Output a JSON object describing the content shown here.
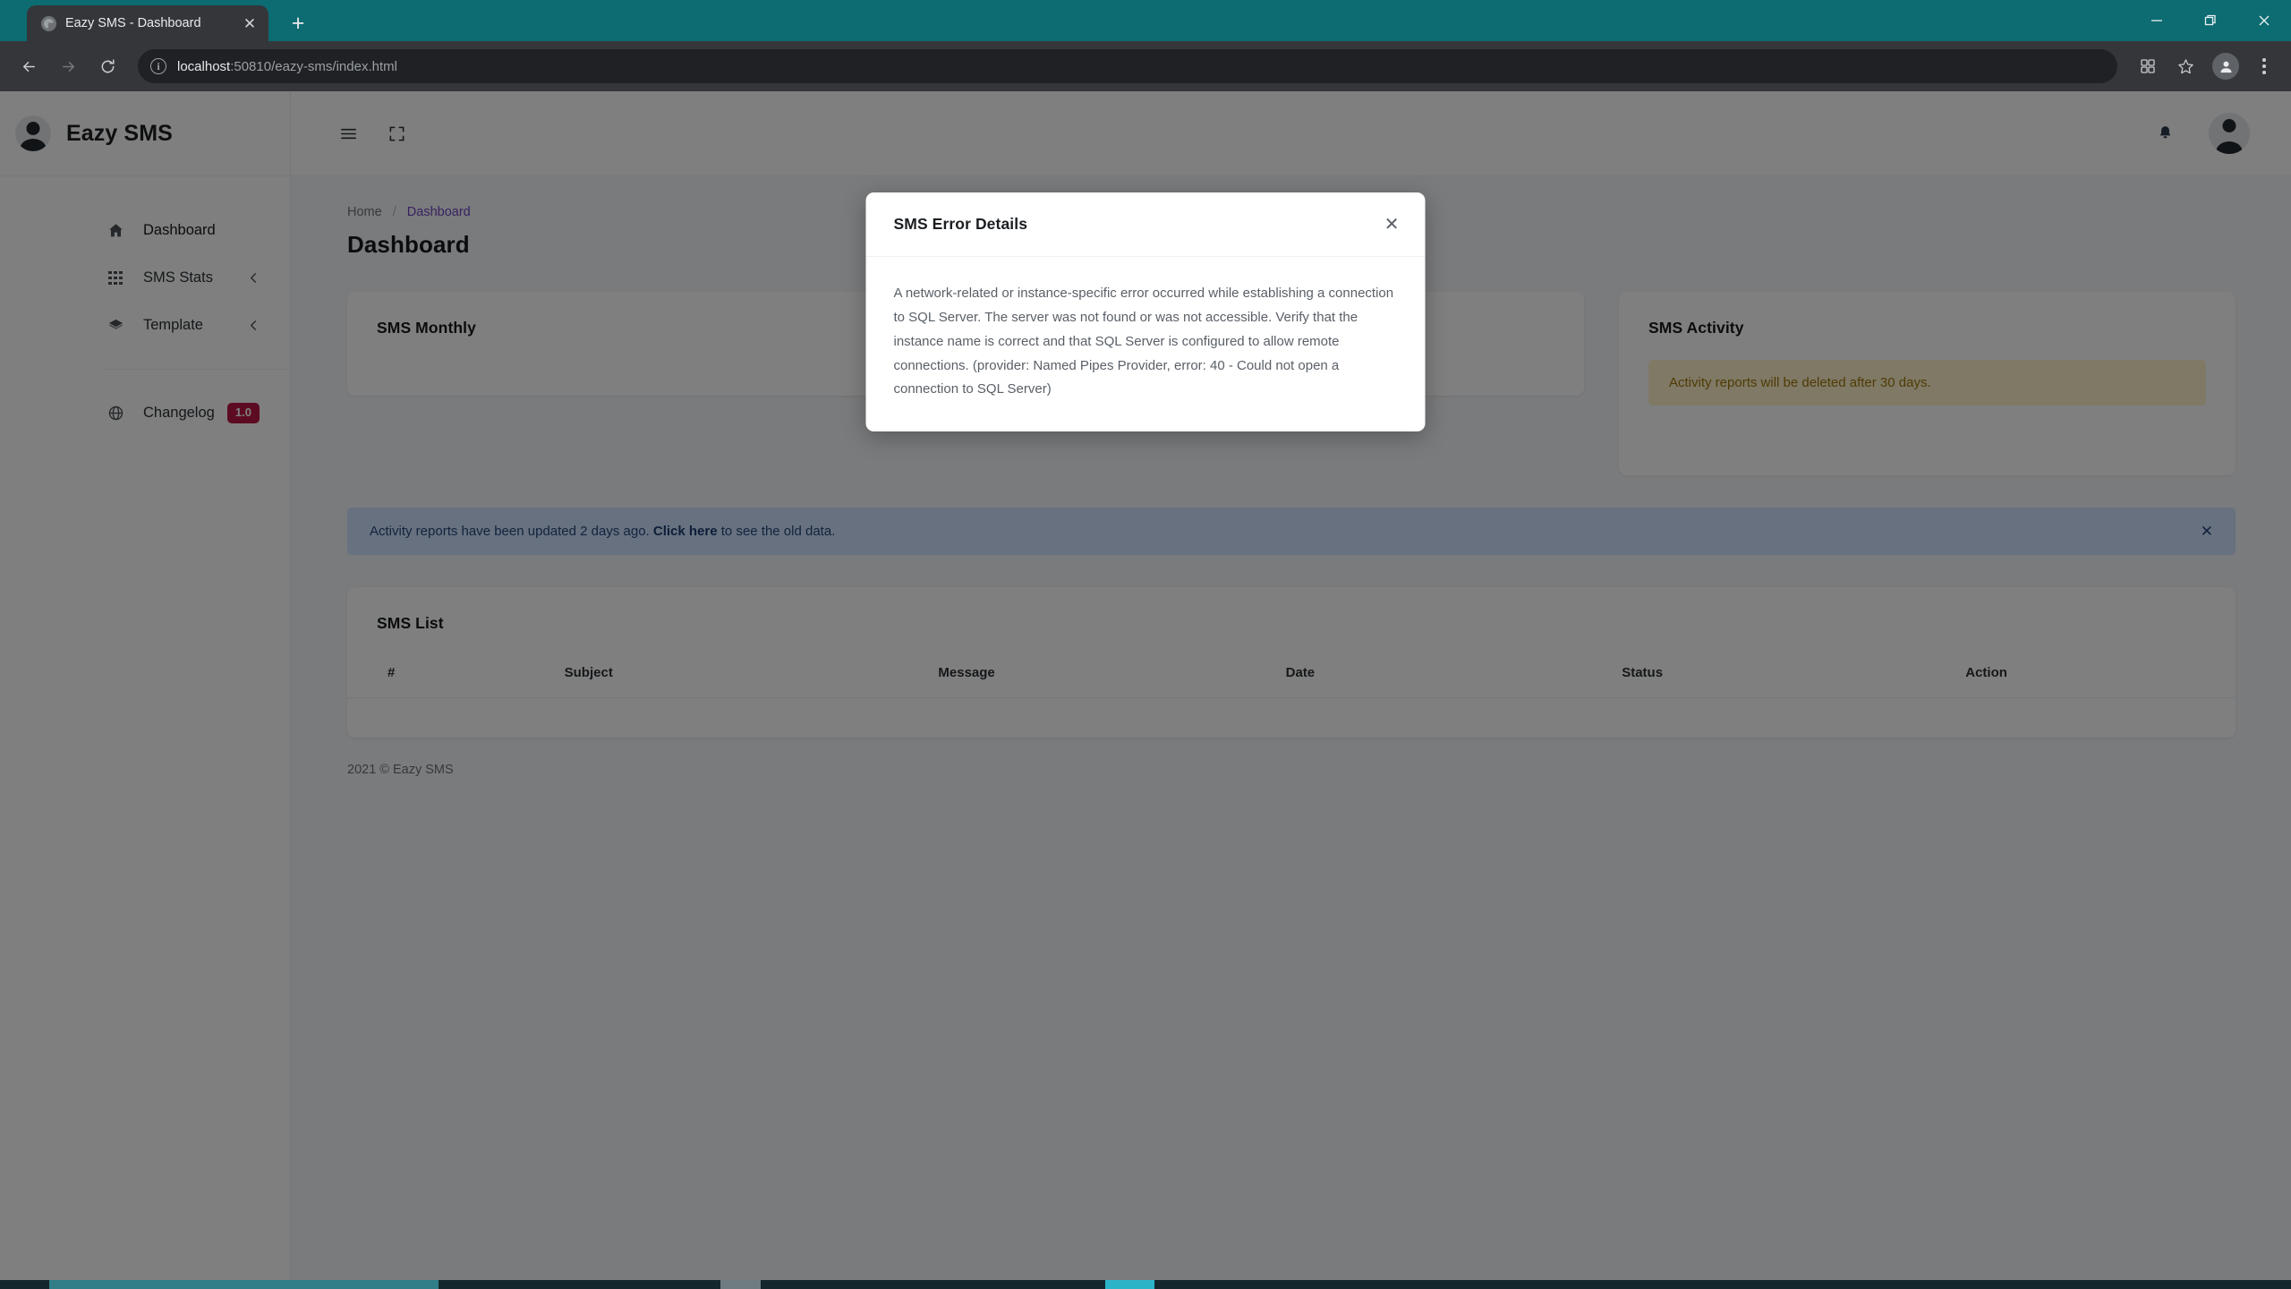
{
  "browser": {
    "tab": {
      "title": "Eazy SMS - Dashboard",
      "favicon_icon": "globe-icon",
      "close_icon": "close-icon"
    },
    "new_tab_label": "+",
    "window_controls": {
      "minimize": "minimize-icon",
      "restore": "restore-icon",
      "close": "close-icon"
    },
    "toolbar": {
      "back_icon": "back-arrow-icon",
      "forward_icon": "forward-arrow-icon",
      "reload_icon": "reload-icon",
      "site_info_icon": "info-icon",
      "url_host": "localhost",
      "url_rest": ":50810/eazy-sms/index.html",
      "extensions_icon": "extensions-icon",
      "bookmark_icon": "star-icon",
      "profile_icon": "profile-avatar-icon",
      "menu_icon": "kebab-menu-icon"
    }
  },
  "sidebar": {
    "brand": "Eazy SMS",
    "avatar_icon": "user-avatar-icon",
    "items": [
      {
        "label": "Dashboard",
        "icon": "home-icon",
        "active": true
      },
      {
        "label": "SMS Stats",
        "icon": "grid-icon",
        "chevron": "chevron-left-icon"
      },
      {
        "label": "Template",
        "icon": "layers-icon",
        "chevron": "chevron-left-icon"
      },
      {
        "label": "Changelog",
        "icon": "globe-icon",
        "badge": "1.0"
      }
    ]
  },
  "topbar": {
    "menu_toggle_icon": "hamburger-menu-icon",
    "fullscreen_icon": "fullscreen-icon",
    "notification_icon": "bell-icon",
    "avatar_icon": "user-avatar-icon"
  },
  "breadcrumb": {
    "home": "Home",
    "separator": "/",
    "current": "Dashboard"
  },
  "page_title": "Dashboard",
  "cards": {
    "monthly": {
      "title": "SMS Monthly"
    },
    "activity": {
      "title": "SMS Activity",
      "alert": "Activity reports will be deleted after 30 days."
    }
  },
  "info_alert": {
    "text_before": "Activity reports have been updated 2 days ago. ",
    "link": "Click here",
    "text_after": " to see the old data.",
    "close_icon": "close-icon"
  },
  "sms_list": {
    "title": "SMS List",
    "columns": [
      "#",
      "Subject",
      "Message",
      "Date",
      "Status",
      "Action"
    ],
    "rows": []
  },
  "footer": "2021 © Eazy SMS",
  "modal": {
    "title": "SMS Error Details",
    "close_icon": "close-icon",
    "body": "A network-related or instance-specific error occurred while establishing a connection to SQL Server. The server was not found or was not accessible. Verify that the instance name is correct and that SQL Server is configured to allow remote connections. (provider: Named Pipes Provider, error: 40 - Could not open a connection to SQL Server)"
  },
  "colors": {
    "tabstrip": "#0d6b72",
    "accent_purple": "#6f42c1",
    "badge_crimson": "#ba1744",
    "alert_warning_bg": "#fff3cd",
    "alert_warning_text": "#a07606",
    "alert_info_bg": "#cfe2ff",
    "alert_info_text": "#24477e",
    "page_bg": "#f5f6fa"
  }
}
